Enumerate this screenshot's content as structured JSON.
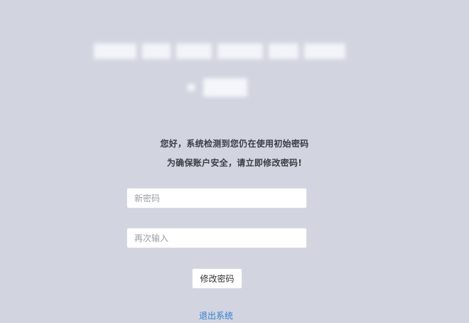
{
  "notice": {
    "line1": "您好，系统检测到您仍在使用初始密码",
    "line2": "为确保账户安全，请立即修改密码!"
  },
  "form": {
    "new_password_placeholder": "新密码",
    "confirm_password_placeholder": "再次输入",
    "submit_label": "修改密码"
  },
  "logout_label": "退出系统",
  "colors": {
    "background": "#d2d5df",
    "link": "#2d7fd3"
  }
}
